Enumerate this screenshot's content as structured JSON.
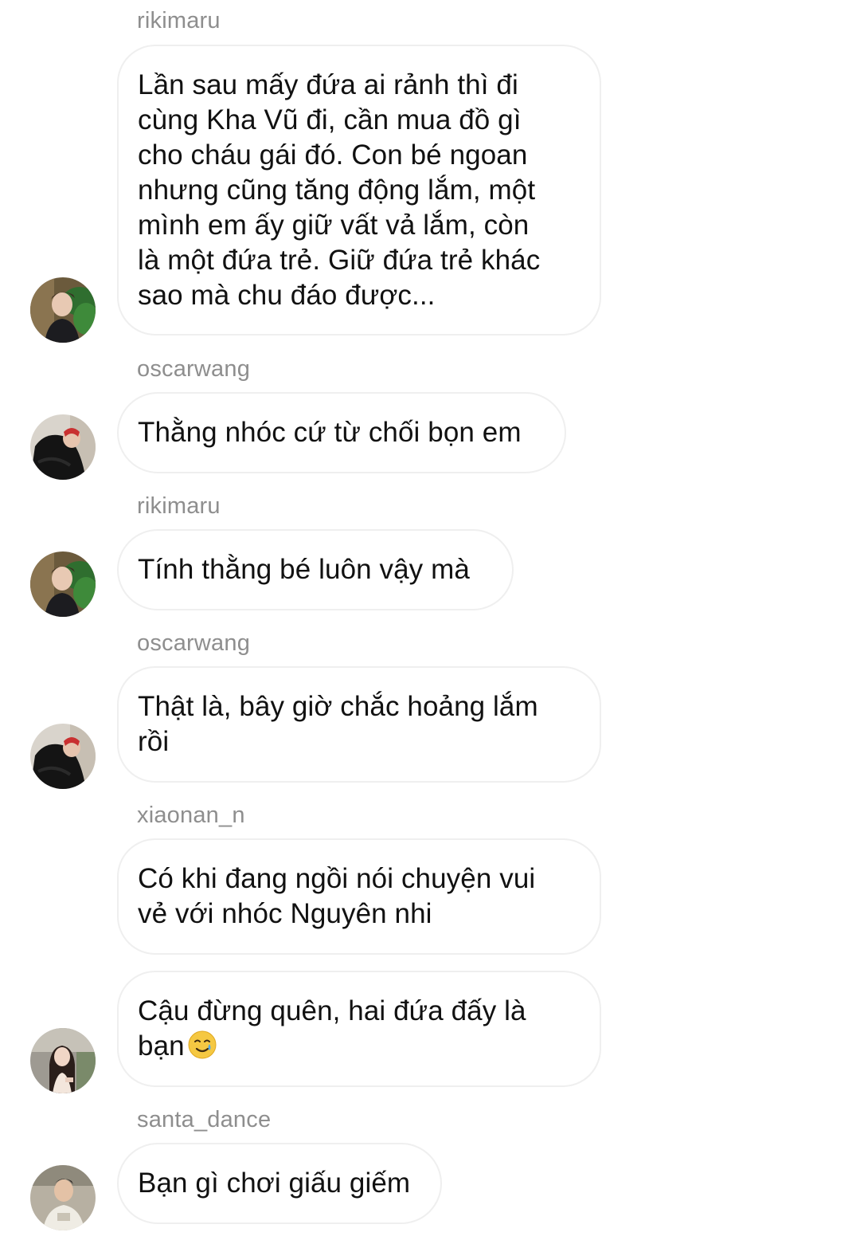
{
  "messages": [
    {
      "username": "rikimaru",
      "lines": [
        "Lần sau mấy đứa ai rảnh thì đi",
        "cùng Kha Vũ đi, cần mua đồ gì",
        "cho cháu gái đó. Con bé ngoan",
        "nhưng cũng tăng động lắm, một",
        "mình em ấy giữ vất vả lắm, còn",
        "là một đứa trẻ. Giữ đứa trẻ khác",
        "sao mà chu đáo được..."
      ],
      "avatar": "avatar-rikimaru"
    },
    {
      "username": "oscarwang",
      "lines": [
        "Thằng nhóc cứ từ chối bọn em"
      ],
      "avatar": "avatar-oscarwang"
    },
    {
      "username": "rikimaru",
      "lines": [
        "Tính thằng bé luôn vậy mà"
      ],
      "avatar": "avatar-rikimaru"
    },
    {
      "username": "oscarwang",
      "lines": [
        "Thật là, bây giờ chắc hoảng lắm",
        "rồi"
      ],
      "avatar": "avatar-oscarwang"
    },
    {
      "username": "xiaonan_n",
      "lines": [
        "Có khi đang ngồi nói chuyện vui",
        "vẻ với nhóc Nguyên nhi"
      ],
      "avatar": null
    },
    {
      "username": null,
      "lines": [
        "Cậu đừng quên, hai đứa đấy là",
        "bạn"
      ],
      "emoji": "smiling-face-with-tear-emoji",
      "avatar": "avatar-xiaonan"
    },
    {
      "username": "santa_dance",
      "lines": [
        "Bạn gì chơi giấu giếm"
      ],
      "avatar": "avatar-santa"
    }
  ],
  "colors": {
    "username": "#8e8e8e",
    "bubble_border": "#efefef",
    "text": "#111111",
    "background": "#ffffff"
  }
}
